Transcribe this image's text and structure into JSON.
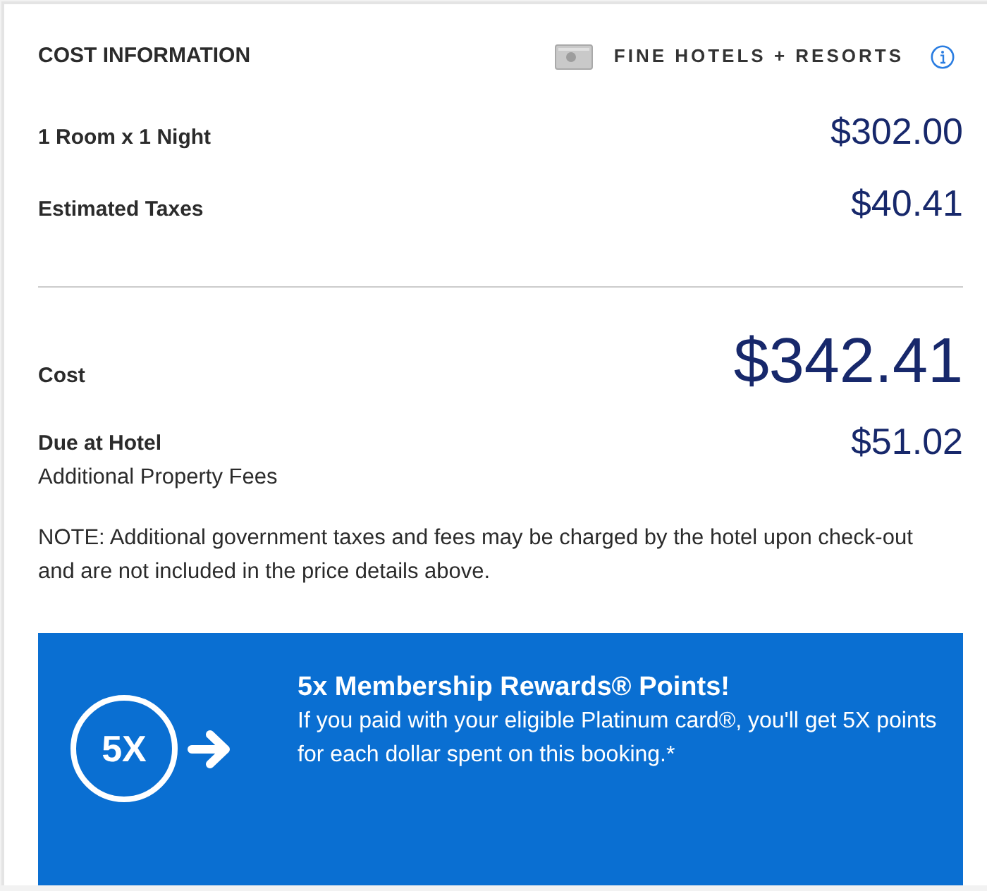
{
  "header": {
    "title": "COST INFORMATION",
    "brand": "FINE HOTELS + RESORTS"
  },
  "line_items": [
    {
      "label": "1 Room x 1 Night",
      "amount": "$302.00"
    },
    {
      "label": "Estimated Taxes",
      "amount": "$40.41"
    }
  ],
  "total": {
    "label": "Cost",
    "amount": "$342.41"
  },
  "due_at_hotel": {
    "label": "Due at Hotel",
    "sublabel": "Additional Property Fees",
    "amount": "$51.02"
  },
  "note": "NOTE: Additional government taxes and fees may be charged by the hotel upon check-out and are not included in the price details above.",
  "promo": {
    "badge": "5X",
    "title": "5x Membership Rewards® Points!",
    "text": "If you paid with your eligible Platinum card®, you'll get 5X points for each dollar spent on this booking.*"
  }
}
